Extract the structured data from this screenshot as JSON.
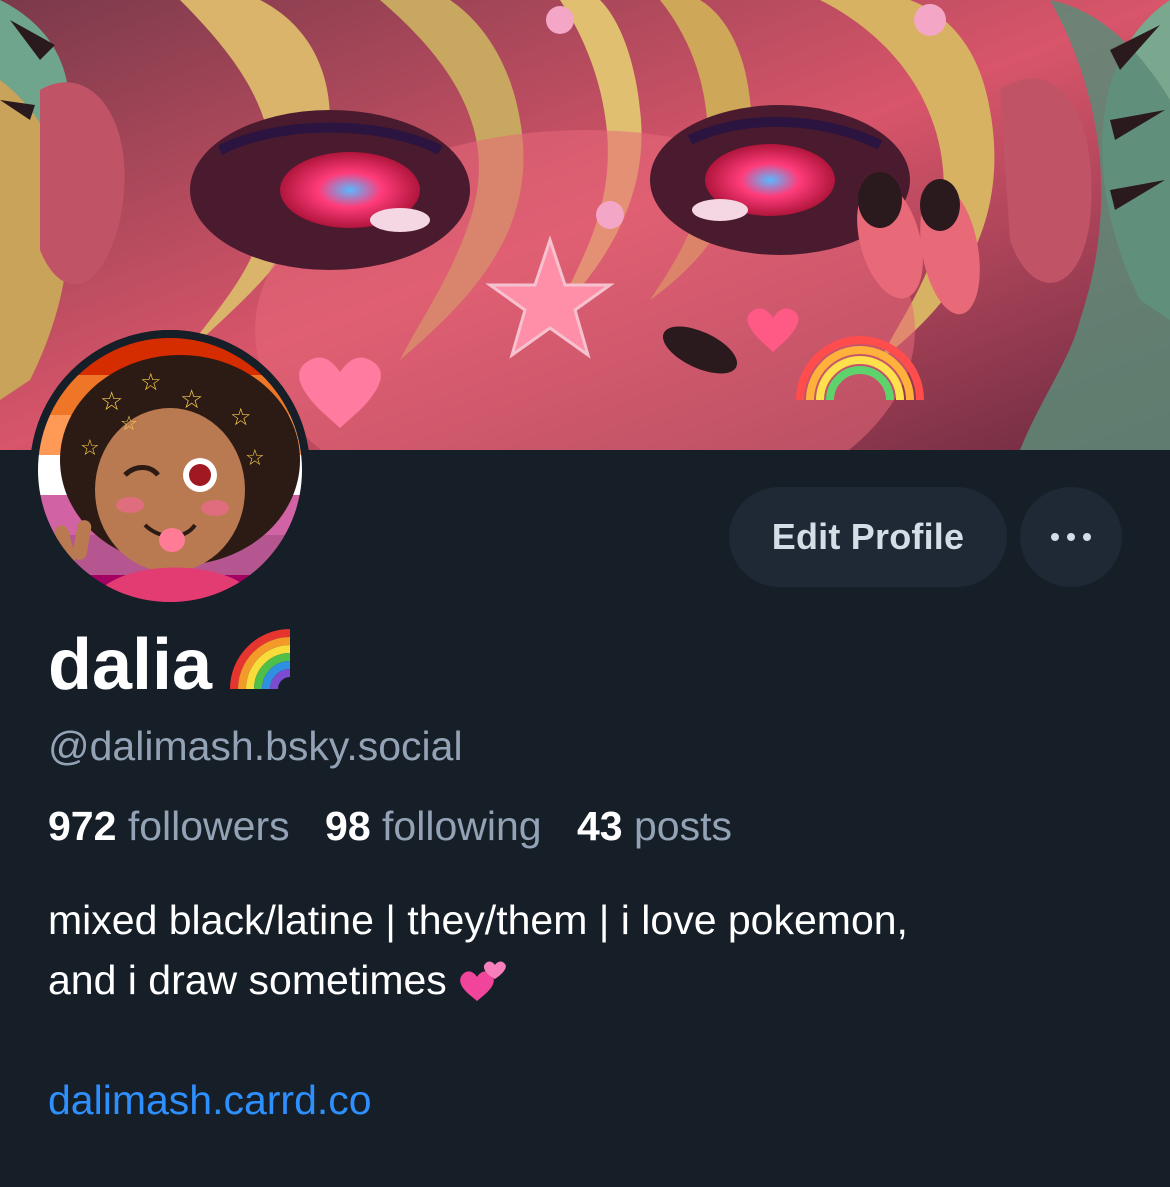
{
  "profile": {
    "display_name": "dalia",
    "name_emoji": "rainbow-emoji",
    "handle": "@dalimash.bsky.social",
    "stats": {
      "followers_count": "972",
      "followers_label": "followers",
      "following_count": "98",
      "following_label": "following",
      "posts_count": "43",
      "posts_label": "posts"
    },
    "bio_line1": "mixed black/latine | they/them | i love pokemon,",
    "bio_line2": "and i draw sometimes",
    "bio_emoji": "two-hearts-emoji",
    "link": "dalimash.carrd.co"
  },
  "actions": {
    "edit_profile_label": "Edit Profile",
    "more_icon": "ellipsis-icon"
  },
  "colors": {
    "background": "#161e27",
    "button_bg": "#1e2935",
    "secondary_text": "#93a3b5",
    "link": "#2e8fff",
    "primary_text": "#ffffff"
  }
}
